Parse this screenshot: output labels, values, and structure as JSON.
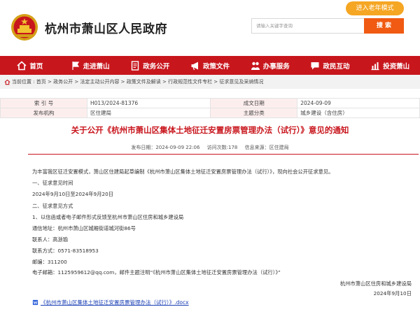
{
  "header": {
    "site_title": "杭州市萧山区人民政府",
    "elder_mode_label": "进入老年模式",
    "search_placeholder": "请输入关键字查询",
    "search_button": "搜 索"
  },
  "nav": {
    "items": [
      {
        "label": "首页",
        "icon": "home-icon"
      },
      {
        "label": "走进萧山",
        "icon": "flag-icon"
      },
      {
        "label": "政务公开",
        "icon": "document-icon"
      },
      {
        "label": "政策文件",
        "icon": "megaphone-icon"
      },
      {
        "label": "办事服务",
        "icon": "handshake-icon"
      },
      {
        "label": "政民互动",
        "icon": "chat-icon"
      },
      {
        "label": "投资萧山",
        "icon": "chart-icon"
      }
    ]
  },
  "breadcrumb": "当前位置 : 首页 > 政务公开 > 法定主动公开内容 > 政策文件及解读 > 行政规范性文件专栏 > 征求意见及采纳情况",
  "info": {
    "index_label": "索 引 号",
    "index_value": "H013/2024-81376",
    "date_label": "成文日期",
    "date_value": "2024-09-09",
    "org_label": "发布机构",
    "org_value": "区住建局",
    "topic_label": "主题分类",
    "topic_value": "城乡建设（含住房）"
  },
  "doc": {
    "title": "关于公开《杭州市萧山区集体土地征迁安置房票管理办法（试行）》意见的通知",
    "publish_time": "发布日期：2024-09-09 22:06",
    "views": "访问次数:178",
    "source": "信息来源：区住建局",
    "p1": "为丰富我区征迁安置模式，萧山区住建局起草编制《杭州市萧山区集体土地征迁安置房票管理办法（试行）》，现向社会公开征求意见。",
    "p2": "一、征求意见时间",
    "p3": "2024年9月10日至2024年9月20日",
    "p4": "二、征求意见方式",
    "p5": "1、以信函或者电子邮件形式反馈至杭州市萧山区住房和城乡建设局",
    "p6": "通信地址：杭州市萧山区城厢街道城河街86号",
    "p7": "联系人：高浙瑜",
    "p8": "联系方式：0571-83518953",
    "p9": "邮编：311200",
    "p10": "电子邮箱：1125959612@qq.com，邮件主题注明“《杭州市萧山区集体土地征迁安置房票管理办法（试行）》”",
    "signature": "杭州市萧山区住房和城乡建设局",
    "sign_date": "2024年9月10日",
    "attachment": "《杭州市萧山区集体土地征迁安置房票管理办法（试行）》.docx"
  },
  "colors": {
    "brand_red": "#c8161d",
    "search_orange": "#f05a12",
    "elder_orange": "#f5a623"
  }
}
